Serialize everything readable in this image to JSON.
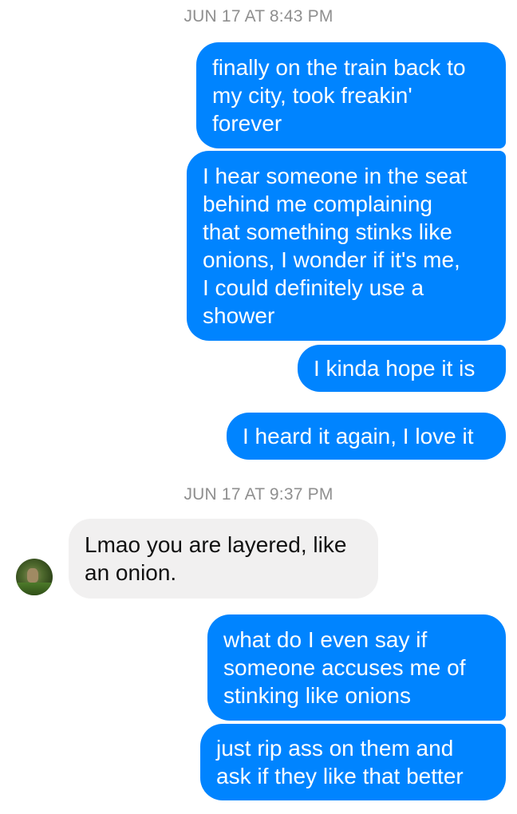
{
  "thread": {
    "timestamps": [
      "JUN 17 AT 8:43 PM",
      "JUN 17 AT 9:37 PM"
    ],
    "messages": [
      {
        "sender": "me",
        "text": "finally on the train back to\nmy city, took freakin'\nforever"
      },
      {
        "sender": "me",
        "text": "I hear someone in the seat\nbehind me complaining\nthat something stinks like\nonions, I wonder if it's me,\nI could definitely use a\nshower"
      },
      {
        "sender": "me",
        "text": "I kinda hope it is"
      },
      {
        "sender": "me",
        "text": "I heard it again, I love it"
      },
      {
        "sender": "them",
        "text": "Lmao you are layered, like\nan onion."
      },
      {
        "sender": "me",
        "text": "what do I even say if\nsomeone accuses me of\nstinking like onions"
      },
      {
        "sender": "me",
        "text": "just rip ass on them and\nask if they like that better"
      }
    ]
  },
  "colors": {
    "outgoing_bubble": "#0084ff",
    "incoming_bubble": "#f1f0f0",
    "timestamp_text": "#8f8f8f"
  },
  "icons": {
    "contact_avatar": "contact-avatar"
  }
}
